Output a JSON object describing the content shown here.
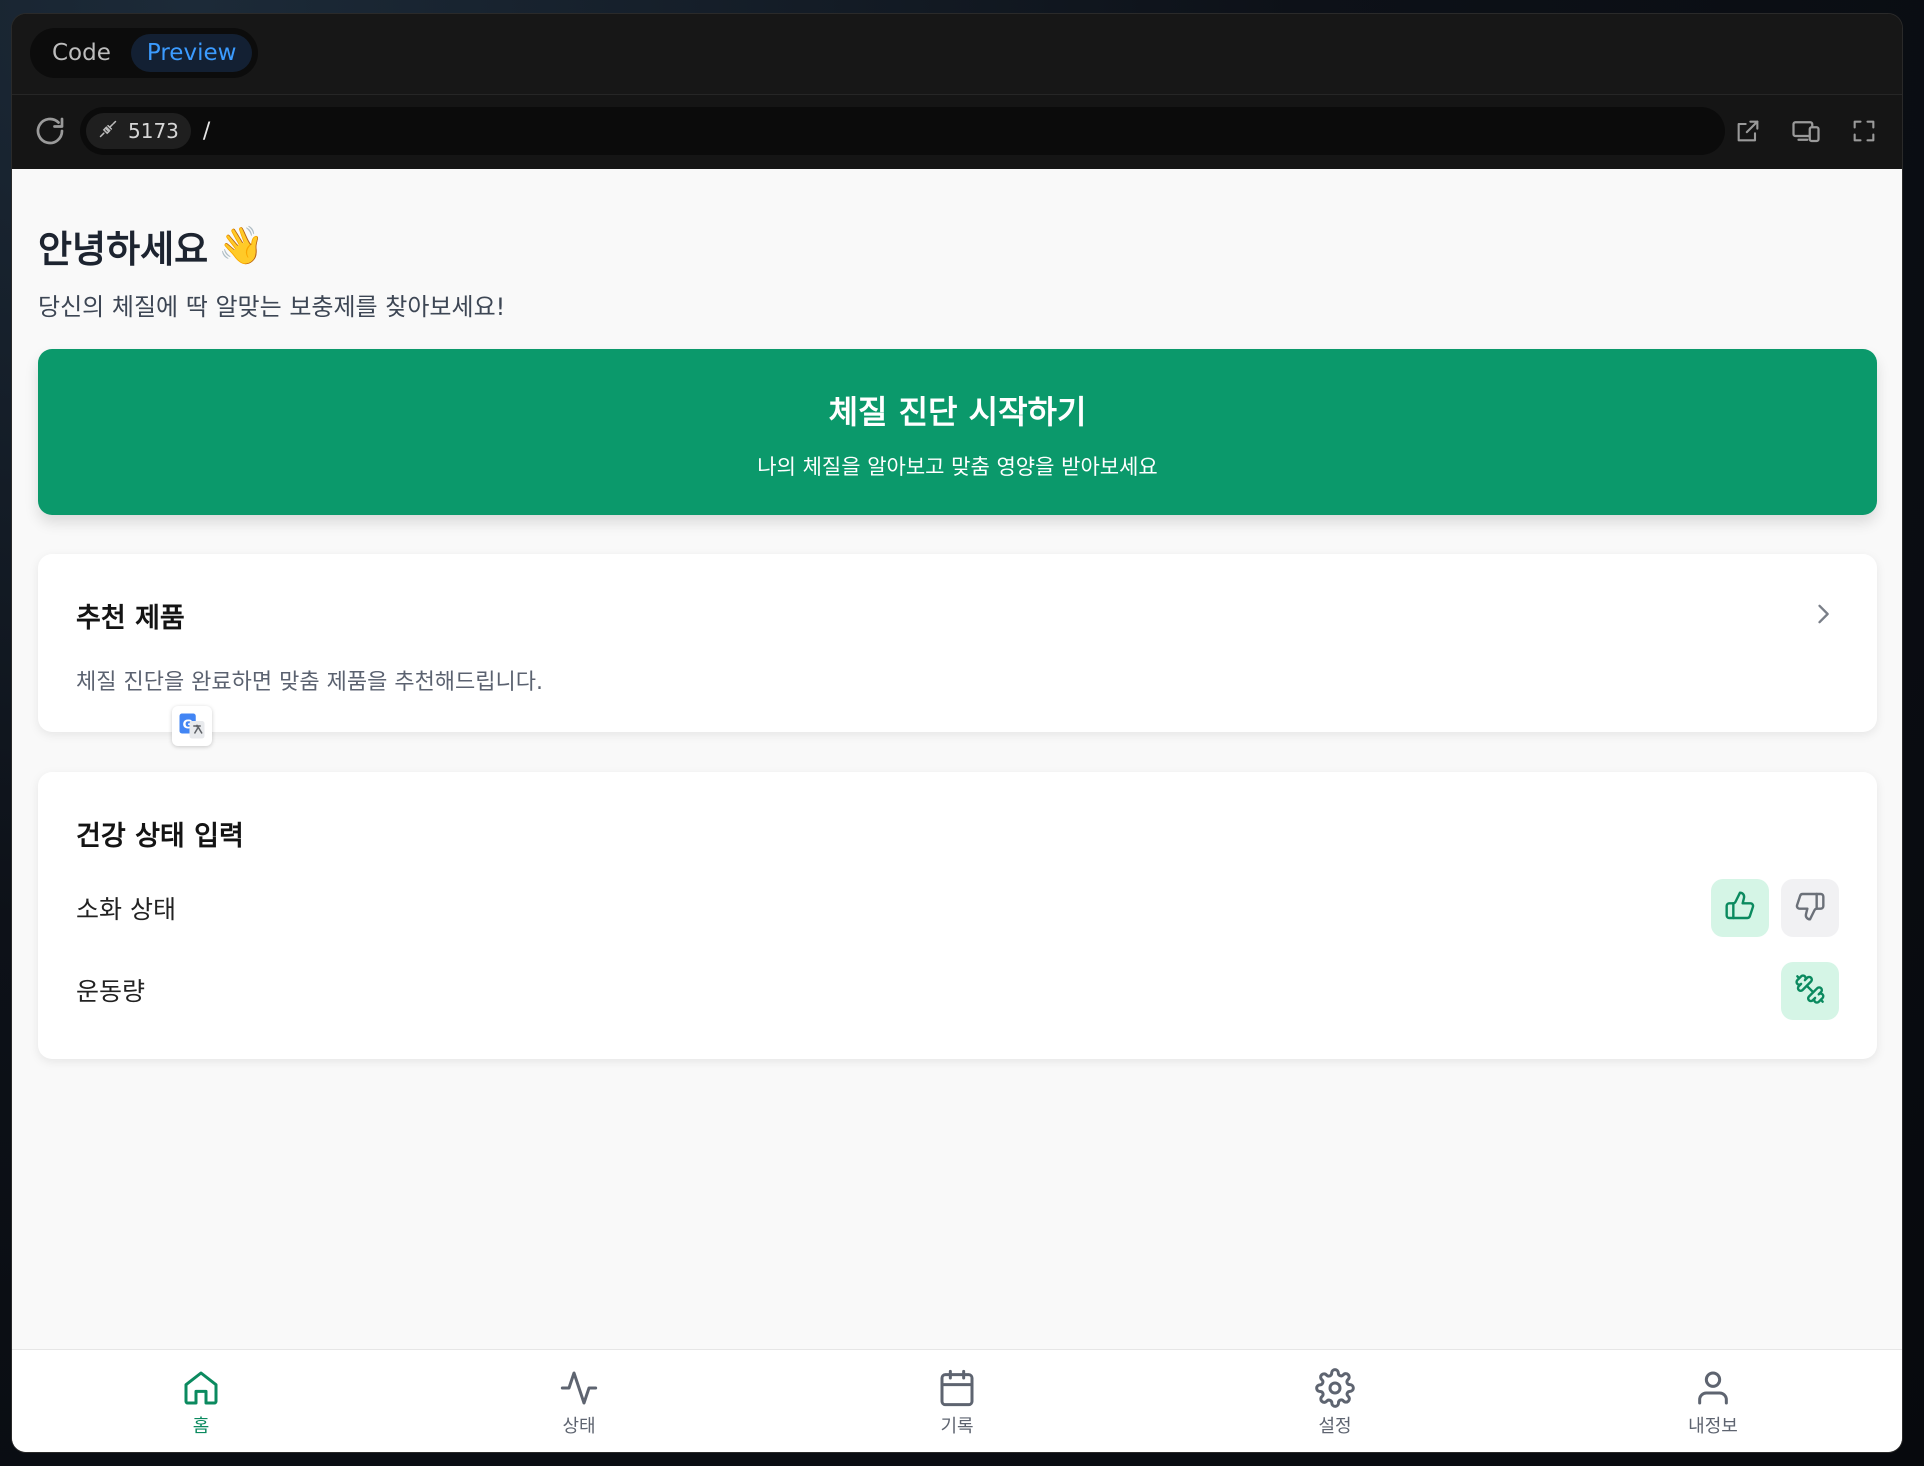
{
  "toolbar": {
    "tabs": [
      {
        "label": "Code",
        "active": false
      },
      {
        "label": "Preview",
        "active": true
      }
    ],
    "port": "5173",
    "path": "/"
  },
  "page": {
    "greeting": "안녕하세요",
    "greeting_emoji": "👋",
    "subtitle": "당신의 체질에 딱 알맞는 보충제를 찾아보세요!",
    "cta": {
      "title": "체질 진단 시작하기",
      "description": "나의 체질을 알아보고 맞춤 영양을 받아보세요"
    },
    "recommend": {
      "title": "추천 제품",
      "description": "체질 진단을 완료하면 맞춤 제품을 추천해드립니다."
    },
    "health": {
      "title": "건강 상태 입력",
      "rows": [
        {
          "label": "소화 상태"
        },
        {
          "label": "운동량"
        }
      ]
    }
  },
  "nav": {
    "items": [
      {
        "label": "홈",
        "icon": "home-icon",
        "active": true
      },
      {
        "label": "상태",
        "icon": "activity-icon",
        "active": false
      },
      {
        "label": "기록",
        "icon": "calendar-icon",
        "active": false
      },
      {
        "label": "설정",
        "icon": "gear-icon",
        "active": false
      },
      {
        "label": "내정보",
        "icon": "user-icon",
        "active": false
      }
    ]
  },
  "colors": {
    "accent": "#0b996b",
    "accent_light": "#d5f5e6",
    "tab_active_text": "#3b9bff"
  }
}
